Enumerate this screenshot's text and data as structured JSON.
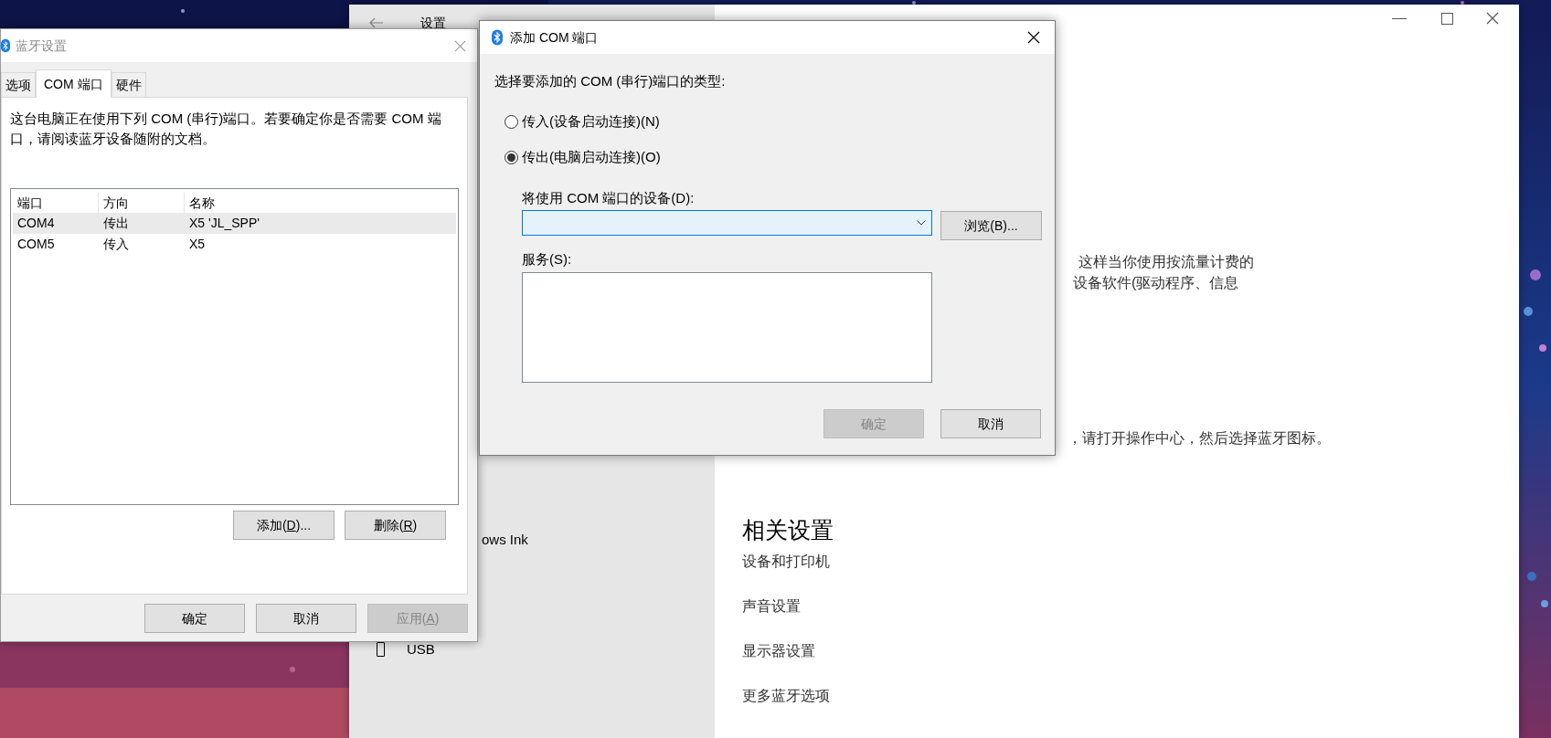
{
  "settings_window": {
    "title": "设置",
    "sidebar_items": [
      {
        "label": "ows Ink",
        "icon": false
      },
      {
        "label": "USB",
        "icon": true
      }
    ],
    "content_lines": [
      "这样当你使用按流量计费的",
      "设备软件(驱动程序、信息",
      "，请打开操作中心，然后选择蓝牙图标。"
    ],
    "related_heading": "相关设置",
    "related_links": [
      "设备和打印机",
      "声音设置",
      "显示器设置",
      "更多蓝牙选项"
    ]
  },
  "bluetooth_dialog": {
    "title": "蓝牙设置",
    "active": false,
    "tabs": [
      {
        "label": "选项",
        "selected": false
      },
      {
        "label": "COM 端口",
        "selected": true
      },
      {
        "label": "硬件",
        "selected": false
      }
    ],
    "description": "这台电脑正在使用下列 COM (串行)端口。若要确定你是否需要 COM 端口，请阅读蓝牙设备随附的文档。",
    "table": {
      "columns": [
        "端口",
        "方向",
        "名称"
      ],
      "rows": [
        {
          "cells": [
            "COM4",
            "传出",
            "X5 'JL_SPP'"
          ],
          "selected": true
        },
        {
          "cells": [
            "COM5",
            "传入",
            "X5"
          ],
          "selected": false
        }
      ]
    },
    "list_buttons": [
      {
        "label": "添加(",
        "mnemonic": "D",
        "label_end": ")...",
        "disabled": false
      },
      {
        "label": "删除(",
        "mnemonic": "R",
        "label_end": ")",
        "disabled": false
      }
    ],
    "footer_buttons": [
      {
        "label": "确定",
        "disabled": false
      },
      {
        "label": "取消",
        "disabled": false
      },
      {
        "label": "应用(",
        "mnemonic": "A",
        "label_end": ")",
        "disabled": true
      }
    ]
  },
  "add_com_dialog": {
    "title": "添加 COM 端口",
    "active": true,
    "prompt": "选择要添加的 COM (串行)端口的类型:",
    "radios": [
      {
        "label": "传入(设备启动连接)(N)",
        "selected": false
      },
      {
        "label": "传出(电脑启动连接)(O)",
        "selected": true
      }
    ],
    "device_label": "将使用 COM 端口的设备(D):",
    "device_combo": {
      "focused": true
    },
    "browse_button": {
      "label": "浏览(B)..."
    },
    "service_label": "服务(S):",
    "buttons": [
      {
        "label": "确定",
        "disabled": true
      },
      {
        "label": "取消",
        "disabled": false
      }
    ]
  }
}
